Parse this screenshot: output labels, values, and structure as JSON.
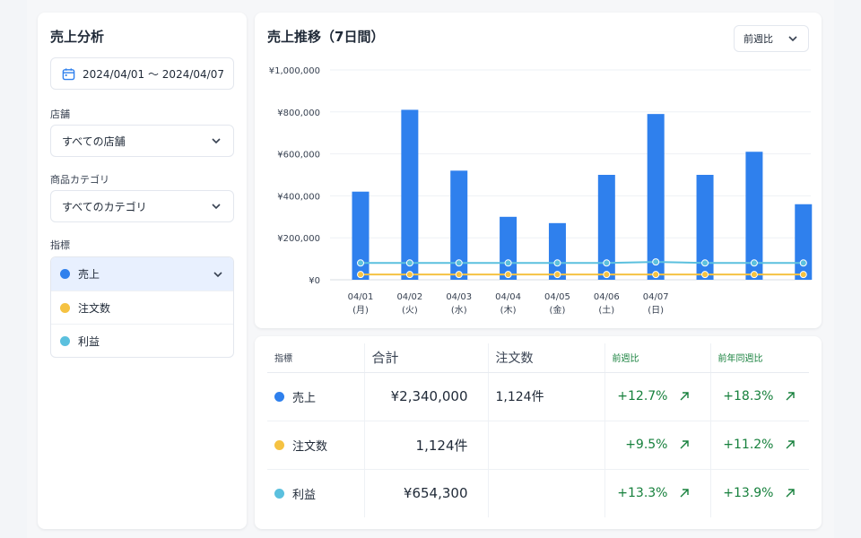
{
  "sidebar": {
    "title": "売上分析",
    "date_range": "2024/04/01 〜 2024/04/07",
    "store_label": "店舗",
    "store_value": "すべての店舗",
    "category_label": "商品カテゴリ",
    "category_value": "すべてのカテゴリ",
    "metric_label": "指標",
    "metrics": [
      {
        "label": "売上",
        "color": "#2f80ed"
      },
      {
        "label": "注文数",
        "color": "#f5c242"
      },
      {
        "label": "利益",
        "color": "#5bc0de"
      }
    ]
  },
  "chart": {
    "title": "売上推移（7日間）",
    "compare_option": "前週比"
  },
  "chart_data": {
    "type": "bar",
    "y_tick_labels": [
      "¥1,000,000",
      "¥800,000",
      "¥600,000",
      "¥400,000",
      "¥200,000",
      "¥0"
    ],
    "ylim": [
      0,
      1000000
    ],
    "x_tick_labels": [
      [
        "04/01",
        "(月)"
      ],
      [
        "04/02",
        "(火)"
      ],
      [
        "04/03",
        "(水)"
      ],
      [
        "04/04",
        "(木)"
      ],
      [
        "04/05",
        "(金)"
      ],
      [
        "04/06",
        "(土)"
      ],
      [
        "04/07",
        "(日)"
      ]
    ],
    "grid": true,
    "series": [
      {
        "name": "売上",
        "type": "bar",
        "color": "#2f80ed",
        "values": [
          420000,
          810000,
          520000,
          300000,
          270000,
          500000,
          790000,
          500000,
          610000,
          360000
        ]
      },
      {
        "name": "利益",
        "type": "line",
        "color": "#5bc0de",
        "values": [
          80000,
          80000,
          80000,
          80000,
          80000,
          80000,
          85000,
          80000,
          80000,
          80000
        ]
      },
      {
        "name": "注文数",
        "type": "line",
        "color": "#f5c242",
        "values": [
          25000,
          25000,
          25000,
          25000,
          25000,
          25000,
          25000,
          25000,
          25000,
          25000
        ]
      }
    ]
  },
  "table": {
    "headers": [
      "指標",
      "合計",
      "注文数",
      "前週比",
      "前年同週比"
    ],
    "rows": [
      {
        "metric": "売上",
        "color": "#2f80ed",
        "total": "¥2,340,000",
        "orders": "1,124件",
        "wow": "+12.7%",
        "yoy": "+18.3%"
      },
      {
        "metric": "注文数",
        "color": "#f5c242",
        "total": "1,124件",
        "orders": "",
        "wow": "+9.5%",
        "yoy": "+11.2%"
      },
      {
        "metric": "利益",
        "color": "#5bc0de",
        "total": "¥654,300",
        "orders": "",
        "wow": "+13.3%",
        "yoy": "+13.9%"
      }
    ]
  }
}
